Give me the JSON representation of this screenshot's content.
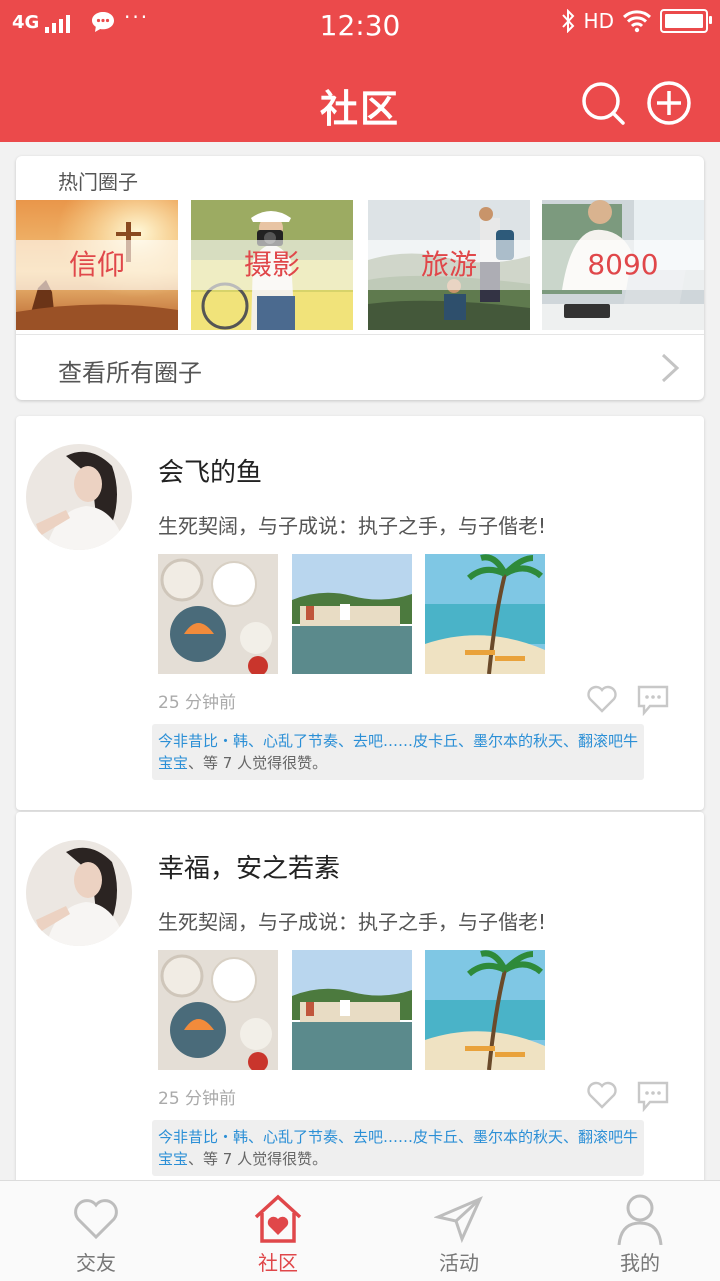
{
  "status_bar": {
    "network": "4G",
    "time": "12:30",
    "hd": "HD",
    "dots": "···"
  },
  "header": {
    "title": "社区",
    "search_icon": "search-icon",
    "add_icon": "plus-circle-icon"
  },
  "hot_circles": {
    "title": "热门圈子",
    "items": [
      {
        "label": "信仰"
      },
      {
        "label": "摄影"
      },
      {
        "label": "旅游"
      },
      {
        "label": "8090"
      }
    ],
    "see_all": "查看所有圈子"
  },
  "posts": [
    {
      "username": "会飞的鱼",
      "text": "生死契阔，与子成说：执子之手，与子偕老!",
      "time": "25 分钟前",
      "liked_by": "今非昔比・韩、心乱了节奏、去吧……皮卡丘、墨尔本的秋天、翻滚吧牛宝宝",
      "liked_suffix": "、等 7 人觉得很赞。"
    },
    {
      "username": "幸福，安之若素",
      "text": "生死契阔，与子成说：执子之手，与子偕老!",
      "time": "25 分钟前",
      "liked_by": "今非昔比・韩、心乱了节奏、去吧……皮卡丘、墨尔本的秋天、翻滚吧牛宝宝",
      "liked_suffix": "、等 7 人觉得很赞。"
    }
  ],
  "tabs": [
    {
      "label": "交友",
      "icon": "heart-outline-icon"
    },
    {
      "label": "社区",
      "icon": "home-heart-icon",
      "active": true
    },
    {
      "label": "活动",
      "icon": "paper-plane-icon"
    },
    {
      "label": "我的",
      "icon": "person-icon"
    }
  ],
  "colors": {
    "primary": "#eb4a4b",
    "link": "#2b8fd6",
    "background": "#f2f2f2"
  }
}
